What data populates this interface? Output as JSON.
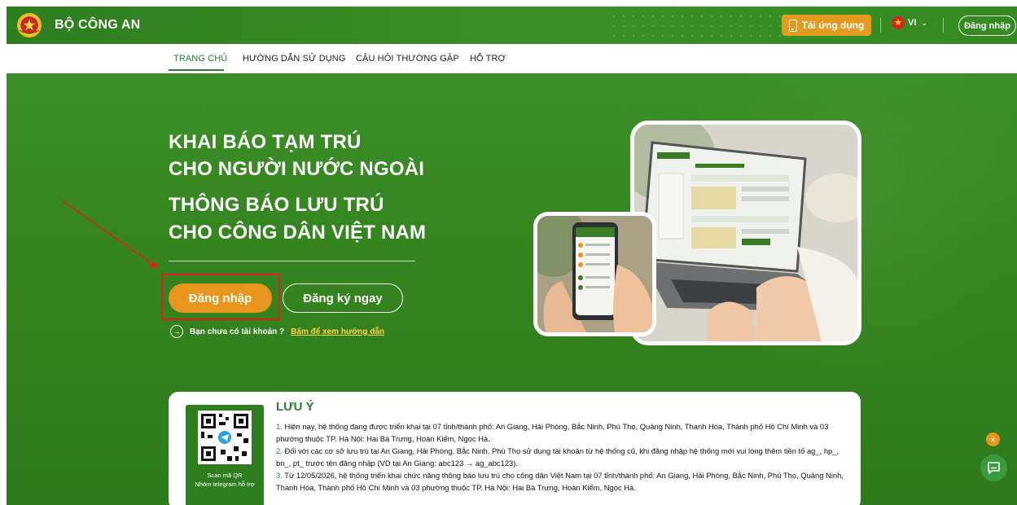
{
  "header": {
    "brand": "BỘ CÔNG AN",
    "download_app_label": "Tải ứng dụng",
    "language": "VI",
    "login_label": "Đăng nhập"
  },
  "nav": {
    "items": [
      {
        "label": "TRANG CHỦ",
        "active": true
      },
      {
        "label": "HƯỚNG DẪN SỬ DỤNG",
        "active": false
      },
      {
        "label": "CÂU HỎI THƯỜNG GẶP",
        "active": false
      },
      {
        "label": "HỖ TRỢ",
        "active": false
      }
    ]
  },
  "hero": {
    "line1": "KHAI BÁO TẠM TRÚ",
    "line2": "CHO NGƯỜI NƯỚC NGOÀI",
    "line3": "THÔNG BÁO LƯU TRÚ",
    "line4": "CHO CÔNG DÂN VIỆT NAM",
    "login_button": "Đăng nhập",
    "register_button": "Đăng ký ngay",
    "hint_text": "Bạn chưa có tài khoản ?",
    "hint_link": "Bấm để xem hướng dẫn"
  },
  "notice": {
    "title": "LƯU Ý",
    "qr_caption_1": "Scan mã QR",
    "qr_caption_2": "Nhóm telegram hỗ trợ",
    "items": [
      {
        "num": "1.",
        "text": "Hiện nay, hệ thống đang được triển khai tại 07 tỉnh/thành phố: An Giang, Hải Phòng, Bắc Ninh, Phú Thọ, Quảng Ninh, Thanh Hóa, Thành phố Hồ Chí Minh và 03 phường thuộc TP. Hà Nội: Hai Bà Trưng, Hoàn Kiếm, Ngọc Hà."
      },
      {
        "num": "2.",
        "text": "Đối với các cơ sở lưu trú tại An Giang, Hải Phòng, Bắc Ninh, Phú Thọ sử dụng tài khoản từ hệ thống cũ, khi đăng nhập hệ thống mới vui lòng thêm tiền tố ag_, hp_, bn_, pt_ trước tên đăng nhập (VD tại An Giang: abc123 → ag_abc123)."
      },
      {
        "num": "3.",
        "text": "Từ 12/05/2026, hệ thống triển khai chức năng thông báo lưu trú cho công dân Việt Nam tại 07 tỉnh/thành phố: An Giang, Hải Phòng, Bắc Ninh, Phú Thọ, Quảng Ninh, Thanh Hóa, Thành phố Hồ Chí Minh và 03 phường thuộc TP. Hà Nội: Hai Bà Trưng, Hoàn Kiếm, Ngọc Hà."
      }
    ]
  },
  "floating": {
    "close_symbol": "×"
  },
  "colors": {
    "primary_green": "#2e7d1f",
    "accent_orange": "#e8951d",
    "highlight_red": "#e41e1e"
  }
}
